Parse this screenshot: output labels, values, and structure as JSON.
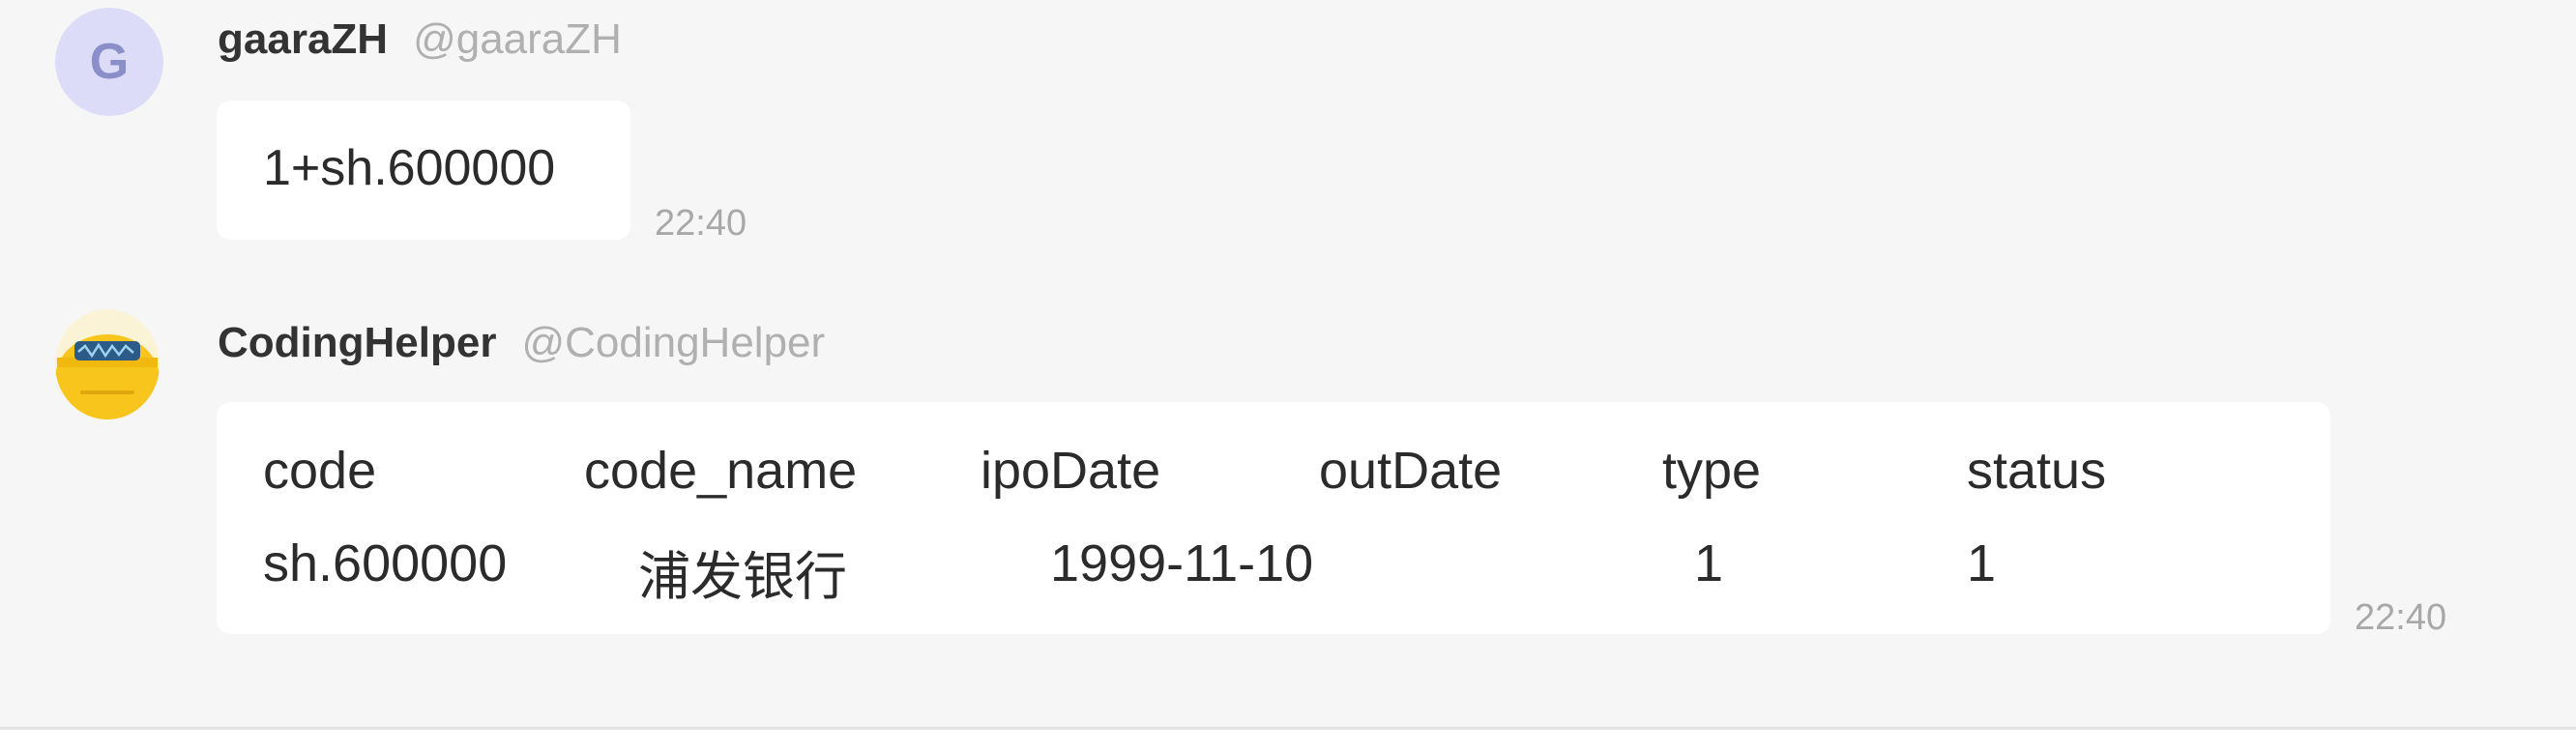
{
  "messages": [
    {
      "avatar_letter": "G",
      "sender_name": "gaaraZH",
      "sender_handle": "@gaaraZH",
      "text": "1+sh.600000",
      "time": "22:40"
    },
    {
      "avatar_icon": "yellow-bot-avatar-icon",
      "sender_name": "CodingHelper",
      "sender_handle": "@CodingHelper",
      "table": {
        "headers": [
          "code",
          "code_name",
          "ipoDate",
          "outDate",
          "type",
          "status"
        ],
        "rows": [
          [
            "sh.600000",
            "浦发银行",
            "1999-11-10",
            "",
            "1",
            "1"
          ]
        ]
      },
      "time": "22:40"
    }
  ],
  "colors": {
    "background": "#f6f6f6",
    "bubble": "#ffffff",
    "avatar_letter_bg": "#dcdcf8",
    "avatar_letter_fg": "#8b8fc9",
    "bot_yellow": "#f8c51c"
  }
}
